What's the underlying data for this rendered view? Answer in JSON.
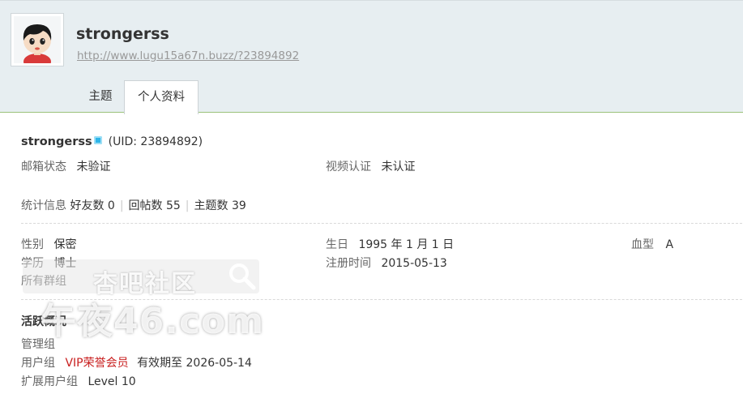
{
  "profile": {
    "username": "strongerss",
    "space_url": "http://www.lugu15a67n.buzz/?23894892"
  },
  "tabs": [
    {
      "label": "主题",
      "active": false
    },
    {
      "label": "个人资料",
      "active": true
    }
  ],
  "info": {
    "username": "strongerss",
    "uid_text": "(UID: 23894892)",
    "email_status_label": "邮箱状态",
    "email_status_value": "未验证",
    "video_label": "视频认证",
    "video_value": "未认证",
    "stats_label": "统计信息",
    "friends": "好友数 0",
    "replies": "回帖数 55",
    "topics": "主题数 39",
    "separator": "|",
    "gender_label": "性别",
    "gender_value": "保密",
    "birthday_label": "生日",
    "birthday_value": "1995 年 1 月 1 日",
    "blood_label": "血型",
    "blood_value": "A",
    "education_label": "学历",
    "education_value": "博士",
    "register_label": "注册时间",
    "register_value": "2015-05-13",
    "groups_label": "所有群组"
  },
  "activity": {
    "title": "活跃概况",
    "admin_group_label": "管理组",
    "user_group_label": "用户组",
    "user_group_value": "VIP荣誉会员",
    "expiry_text": "有效期至 2026-05-14",
    "ext_group_label": "扩展用户组",
    "ext_group_value": "Level 10"
  },
  "watermark": {
    "line1": "杏吧社区",
    "line2": "午夜46.com"
  },
  "colors": {
    "header_bg": "#e7eef1",
    "header_border": "#9bc27a",
    "vip_red": "#c81e1e",
    "verify_blue": "#2db5e9"
  }
}
